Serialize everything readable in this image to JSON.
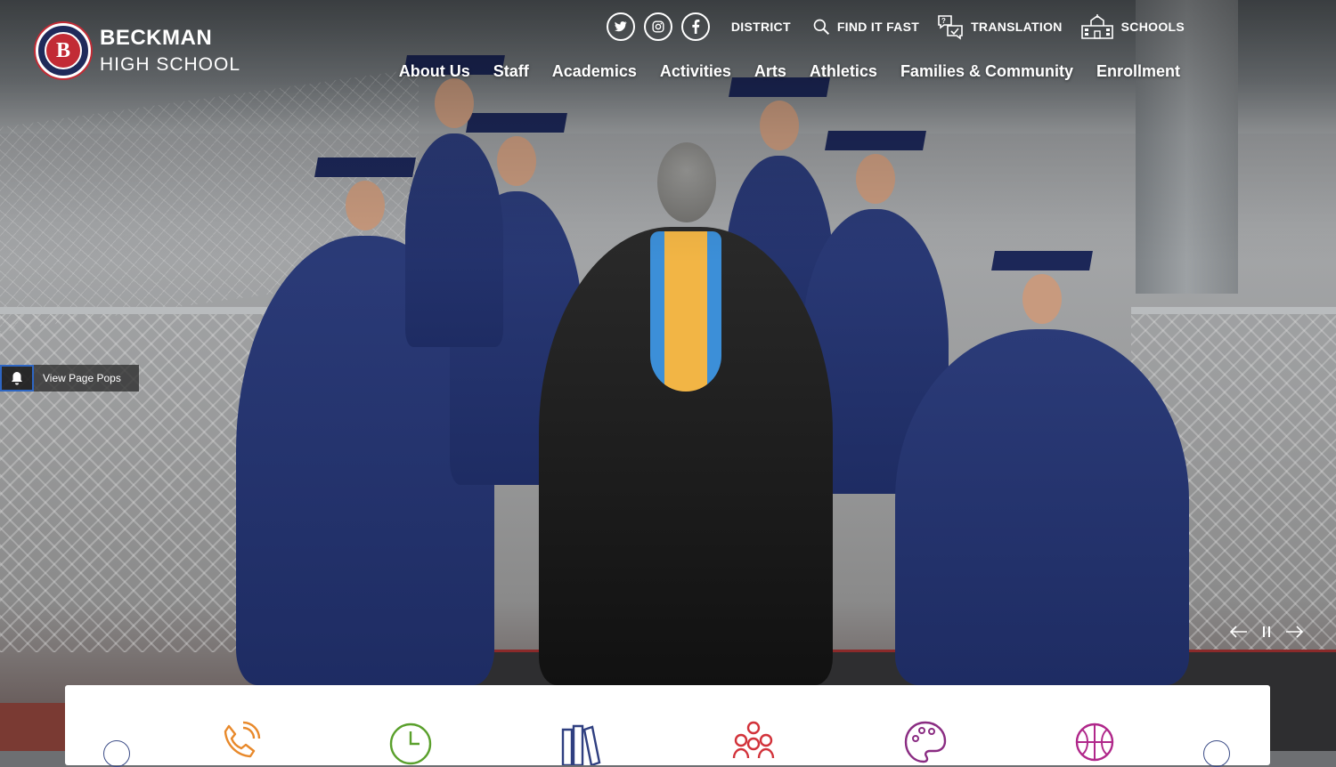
{
  "school": {
    "name_line1": "BECKMAN",
    "name_line2": "HIGH SCHOOL",
    "seal_letter": "B"
  },
  "utility_nav": {
    "social": [
      {
        "name": "twitter-icon",
        "glyph": "🐦"
      },
      {
        "name": "instagram-icon",
        "glyph": "◎"
      },
      {
        "name": "facebook-icon",
        "glyph": "f"
      }
    ],
    "district": "DISTRICT",
    "find_it_fast": "FIND IT FAST",
    "translation": "TRANSLATION",
    "schools": "SCHOOLS"
  },
  "main_nav": [
    "About Us",
    "Staff",
    "Academics",
    "Activities",
    "Arts",
    "Athletics",
    "Families & Community",
    "Enrollment"
  ],
  "page_pops": {
    "label": "View Page Pops"
  },
  "quick_links": {
    "icons": [
      {
        "name": "phone-icon",
        "color": "#e8892b"
      },
      {
        "name": "clock-icon",
        "color": "#5aa02c"
      },
      {
        "name": "book-icon",
        "color": "#2f3f80"
      },
      {
        "name": "group-icon",
        "color": "#d2323a"
      },
      {
        "name": "palette-icon",
        "color": "#8a2c82"
      },
      {
        "name": "sports-ball-icon",
        "color": "#b0278a"
      }
    ]
  },
  "colors": {
    "brand_navy": "#1f2a5a",
    "brand_red": "#c22b35",
    "focus_blue": "#2e66c3"
  }
}
